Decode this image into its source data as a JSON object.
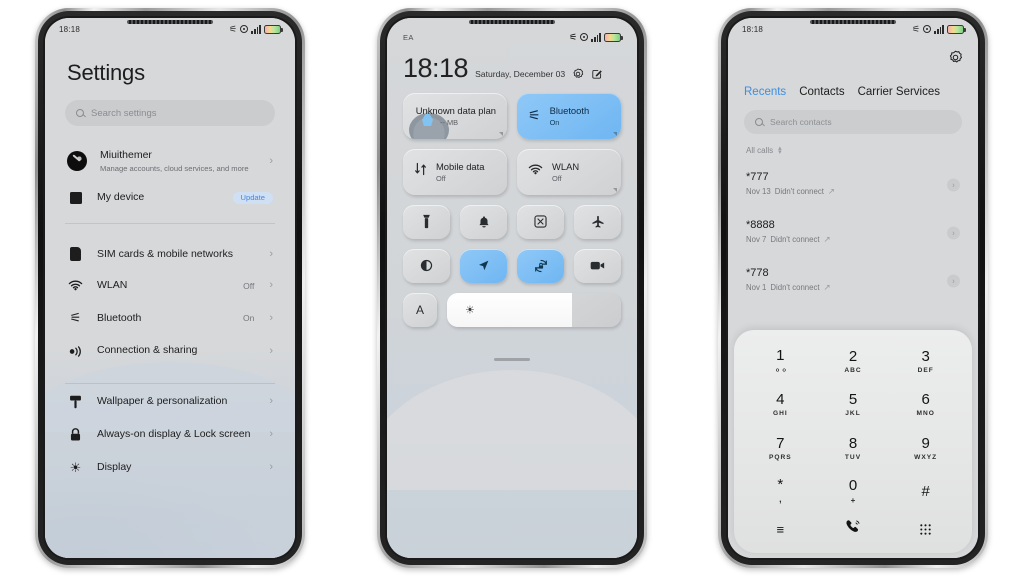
{
  "statusbar": {
    "time": "18:18",
    "bluetooth_icon": "bluetooth-icon",
    "dnd_icon": "dnd-icon",
    "signal_icon": "signal-bars-icon",
    "battery_icon": "battery-icon"
  },
  "phone1": {
    "screen_name": "settings",
    "title": "Settings",
    "search": {
      "placeholder": "Search settings",
      "icon": "search-icon"
    },
    "account": {
      "name": "Miuithemer",
      "subtitle": "Manage accounts, cloud services, and more",
      "avatar_icon": "avatar-icon",
      "chevron": "›"
    },
    "device": {
      "label": "My device",
      "badge": "Update",
      "icon": "device-icon",
      "badge_color": "#4b87d8"
    },
    "group_network": [
      {
        "label": "SIM cards & mobile networks",
        "value": "",
        "icon": "sim-card-icon"
      },
      {
        "label": "WLAN",
        "value": "Off",
        "icon": "wifi-icon"
      },
      {
        "label": "Bluetooth",
        "value": "On",
        "icon": "bluetooth-icon"
      },
      {
        "label": "Connection & sharing",
        "value": "",
        "icon": "connection-sharing-icon"
      }
    ],
    "group_display": [
      {
        "label": "Wallpaper & personalization",
        "value": "",
        "icon": "wallpaper-icon"
      },
      {
        "label": "Always-on display & Lock screen",
        "value": "",
        "icon": "lock-icon"
      },
      {
        "label": "Display",
        "value": "",
        "icon": "brightness-icon"
      }
    ]
  },
  "phone2": {
    "screen_name": "control-center",
    "carrier": "EA",
    "clock": "18:18",
    "date": "Saturday, December 03",
    "settings_icon": "gear-icon",
    "edit_icon": "edit-icon",
    "big_tiles": [
      {
        "label": "Unknown data plan",
        "sub": "-- MB",
        "state": "off",
        "icon": "data-plan-icon"
      },
      {
        "label": "Bluetooth",
        "sub": "On",
        "state": "on",
        "icon": "bluetooth-icon"
      },
      {
        "label": "Mobile data",
        "sub": "Off",
        "state": "off",
        "icon": "mobile-data-icon"
      },
      {
        "label": "WLAN",
        "sub": "Off",
        "state": "off",
        "icon": "wifi-icon"
      }
    ],
    "small_tiles": [
      {
        "icon": "flashlight-icon",
        "state": "off"
      },
      {
        "icon": "bell-icon",
        "state": "off"
      },
      {
        "icon": "screenshot-icon",
        "state": "off"
      },
      {
        "icon": "airplane-icon",
        "state": "off"
      },
      {
        "icon": "dark-mode-icon",
        "state": "off"
      },
      {
        "icon": "location-icon",
        "state": "on"
      },
      {
        "icon": "auto-rotate-lock-icon",
        "state": "on"
      },
      {
        "icon": "screen-record-icon",
        "state": "off"
      }
    ],
    "brightness": {
      "auto_label": "A",
      "icon": "brightness-icon",
      "level": 72
    },
    "drag_handle": "drag-handle"
  },
  "phone3": {
    "screen_name": "dialer",
    "settings_icon": "gear-icon",
    "tabs": [
      {
        "label": "Recents",
        "active": true
      },
      {
        "label": "Contacts",
        "active": false
      },
      {
        "label": "Carrier Services",
        "active": false
      }
    ],
    "active_tab_color": "#3d8fe0",
    "search": {
      "placeholder": "Search contacts",
      "icon": "search-icon"
    },
    "filter": {
      "label": "All calls",
      "icon": "sort-icon"
    },
    "calls": [
      {
        "number": "*777",
        "date": "Nov 13",
        "status": "Didn't connect",
        "direction_icon": "outgoing-call-icon"
      },
      {
        "number": "*8888",
        "date": "Nov 7",
        "status": "Didn't connect",
        "direction_icon": "outgoing-call-icon"
      },
      {
        "number": "*778",
        "date": "Nov 1",
        "status": "Didn't connect",
        "direction_icon": "outgoing-call-icon"
      }
    ],
    "keypad": [
      {
        "digit": "1",
        "letters": "",
        "sub_icon": "voicemail-icon"
      },
      {
        "digit": "2",
        "letters": "ABC",
        "sub_icon": ""
      },
      {
        "digit": "3",
        "letters": "DEF",
        "sub_icon": ""
      },
      {
        "digit": "4",
        "letters": "GHI",
        "sub_icon": ""
      },
      {
        "digit": "5",
        "letters": "JKL",
        "sub_icon": ""
      },
      {
        "digit": "6",
        "letters": "MNO",
        "sub_icon": ""
      },
      {
        "digit": "7",
        "letters": "PQRS",
        "sub_icon": ""
      },
      {
        "digit": "8",
        "letters": "TUV",
        "sub_icon": ""
      },
      {
        "digit": "9",
        "letters": "WXYZ",
        "sub_icon": ""
      },
      {
        "digit": "*",
        "letters": ",",
        "sub_icon": ""
      },
      {
        "digit": "0",
        "letters": "+",
        "sub_icon": ""
      },
      {
        "digit": "#",
        "letters": "",
        "sub_icon": ""
      }
    ],
    "actions": [
      {
        "icon": "menu-icon",
        "glyph": "≡"
      },
      {
        "icon": "call-icon",
        "glyph": "✆"
      },
      {
        "icon": "keypad-icon",
        "glyph": "∷"
      }
    ]
  }
}
